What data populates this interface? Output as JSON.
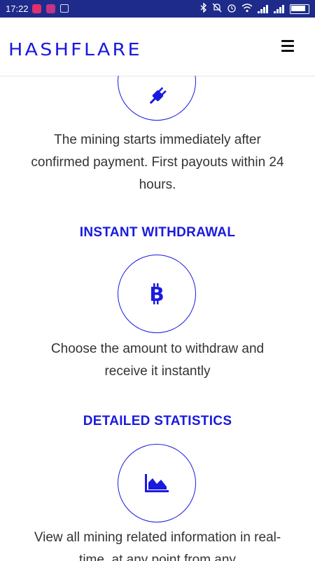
{
  "status_bar": {
    "time": "17:22"
  },
  "header": {
    "logo": "HASHFLARE",
    "menu_icon": "hamburger-menu-icon"
  },
  "features": [
    {
      "icon": "plug-icon",
      "title": "",
      "text": "The mining starts immediately after confirmed payment. First payouts within 24 hours."
    },
    {
      "icon": "bitcoin-icon",
      "title": "INSTANT WITHDRAWAL",
      "text": "Choose the amount to withdraw and receive it instantly"
    },
    {
      "icon": "area-chart-icon",
      "title": "DETAILED STATISTICS",
      "text": "View all mining related information in real-time, at any point from any"
    }
  ],
  "colors": {
    "accent": "#1a1adf",
    "status_bar": "#1e2b8a",
    "body_text": "#333333"
  }
}
